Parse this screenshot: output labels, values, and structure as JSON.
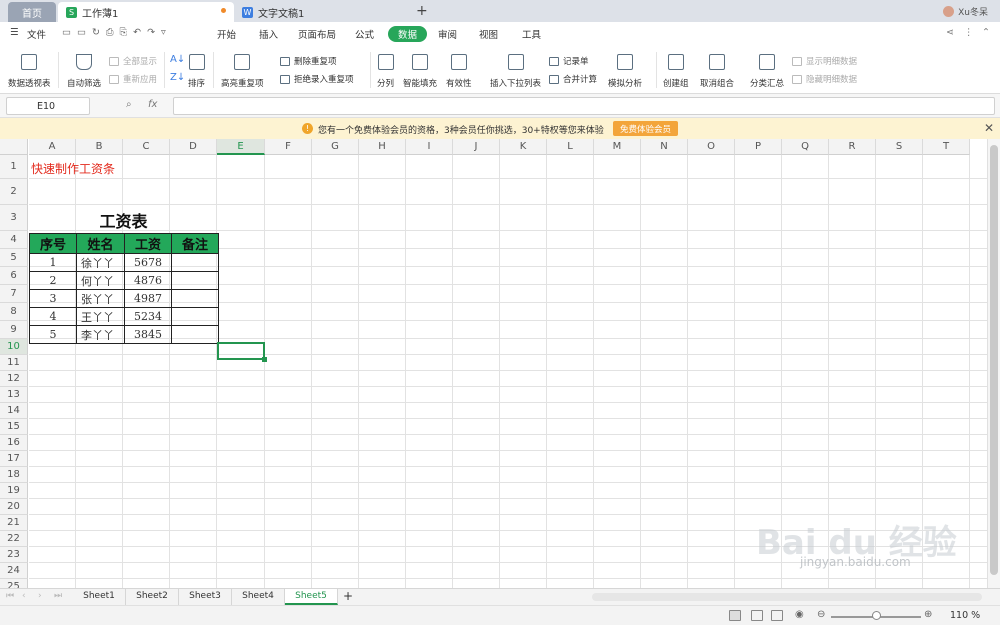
{
  "tabs": {
    "home": "首页",
    "workbook": "工作薄1",
    "document": "文字文稿1",
    "user": "Xu冬呆"
  },
  "menu": {
    "file": "文件",
    "items": [
      "开始",
      "插入",
      "页面布局",
      "公式",
      "数据",
      "审阅",
      "视图",
      "工具"
    ],
    "active": "数据"
  },
  "ribbon": {
    "pivot": "数据透视表",
    "autofilter": "自动筛选",
    "show_all": "全部显示",
    "reapply": "重新应用",
    "sort": "排序",
    "highlight_dup": "高亮重复项",
    "remove_dup": "删除重复项",
    "reject_dup": "拒绝录入重复项",
    "split": "分列",
    "smart_fill": "智能填充",
    "validity": "有效性",
    "dropdown": "插入下拉列表",
    "record_sheet": "记录单",
    "consolidate": "合并计算",
    "what_if": "模拟分析",
    "create_group": "创建组",
    "ungroup": "取消组合",
    "subtotal": "分类汇总",
    "show_detail": "显示明细数据",
    "hide_detail": "隐藏明细数据"
  },
  "formula_bar": {
    "cell_ref": "E10",
    "fx": "fx",
    "value": ""
  },
  "notice": {
    "text": "您有一个免费体验会员的资格，3种会员任你挑选，30+特权等您来体验",
    "button": "免费体验会员"
  },
  "grid": {
    "columns": [
      "A",
      "B",
      "C",
      "D",
      "E",
      "F",
      "G",
      "H",
      "I",
      "J",
      "K",
      "L",
      "M",
      "N",
      "O",
      "P",
      "Q",
      "R",
      "S",
      "T"
    ],
    "rows": [
      "1",
      "2",
      "3",
      "4",
      "5",
      "6",
      "7",
      "8",
      "9",
      "10",
      "11",
      "12",
      "13",
      "14",
      "15",
      "16",
      "17",
      "18",
      "19",
      "20",
      "21",
      "22",
      "23",
      "24",
      "25"
    ],
    "selected_column": "E",
    "selected_row": "10"
  },
  "sheet": {
    "heading": "快速制作工资条",
    "title": "工资表",
    "table_headers": [
      "序号",
      "姓名",
      "工资",
      "备注"
    ],
    "table_rows": [
      [
        "1",
        "徐丫丫",
        "5678",
        ""
      ],
      [
        "2",
        "何丫丫",
        "4876",
        ""
      ],
      [
        "3",
        "张丫丫",
        "4987",
        ""
      ],
      [
        "4",
        "王丫丫",
        "5234",
        ""
      ],
      [
        "5",
        "李丫丫",
        "3845",
        ""
      ]
    ]
  },
  "sheet_tabs": [
    "Sheet1",
    "Sheet2",
    "Sheet3",
    "Sheet4",
    "Sheet5"
  ],
  "active_sheet": "Sheet5",
  "status": {
    "zoom": "110 %"
  },
  "watermark": {
    "brand": "Bai du 经验",
    "url": "jingyan.baidu.com"
  }
}
